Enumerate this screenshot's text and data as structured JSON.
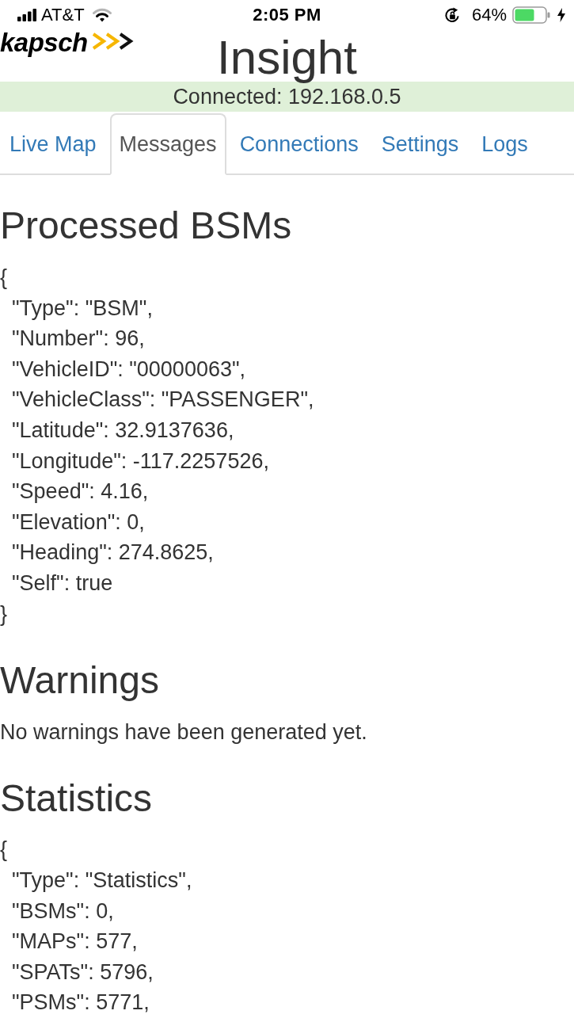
{
  "status_bar": {
    "carrier": "AT&T",
    "time": "2:05 PM",
    "battery": "64%"
  },
  "header": {
    "logo": "kapsch",
    "title": "Insight"
  },
  "connection": {
    "text": "Connected: 192.168.0.5"
  },
  "tabs": [
    {
      "label": "Live Map",
      "selected": false
    },
    {
      "label": "Messages",
      "selected": true
    },
    {
      "label": "Connections",
      "selected": false
    },
    {
      "label": "Settings",
      "selected": false
    },
    {
      "label": "Logs",
      "selected": false
    }
  ],
  "sections": [
    {
      "kind": "json",
      "heading": "Processed BSMs",
      "open": "{",
      "lines": [
        "\"Type\": \"BSM\",",
        "\"Number\": 96,",
        "\"VehicleID\": \"00000063\",",
        "\"VehicleClass\": \"PASSENGER\",",
        "\"Latitude\": 32.9137636,",
        "\"Longitude\": -117.2257526,",
        "\"Speed\": 4.16,",
        "\"Elevation\": 0,",
        "\"Heading\": 274.8625,",
        "\"Self\": true"
      ],
      "close": "}"
    },
    {
      "kind": "text",
      "heading": "Warnings",
      "text": "No warnings have been generated yet."
    },
    {
      "kind": "json",
      "heading": "Statistics",
      "open": "{",
      "lines": [
        "\"Type\": \"Statistics\",",
        "\"BSMs\": 0,",
        "\"MAPs\": 577,",
        "\"SPATs\": 5796,",
        "\"PSMs\": 5771,"
      ]
    }
  ]
}
